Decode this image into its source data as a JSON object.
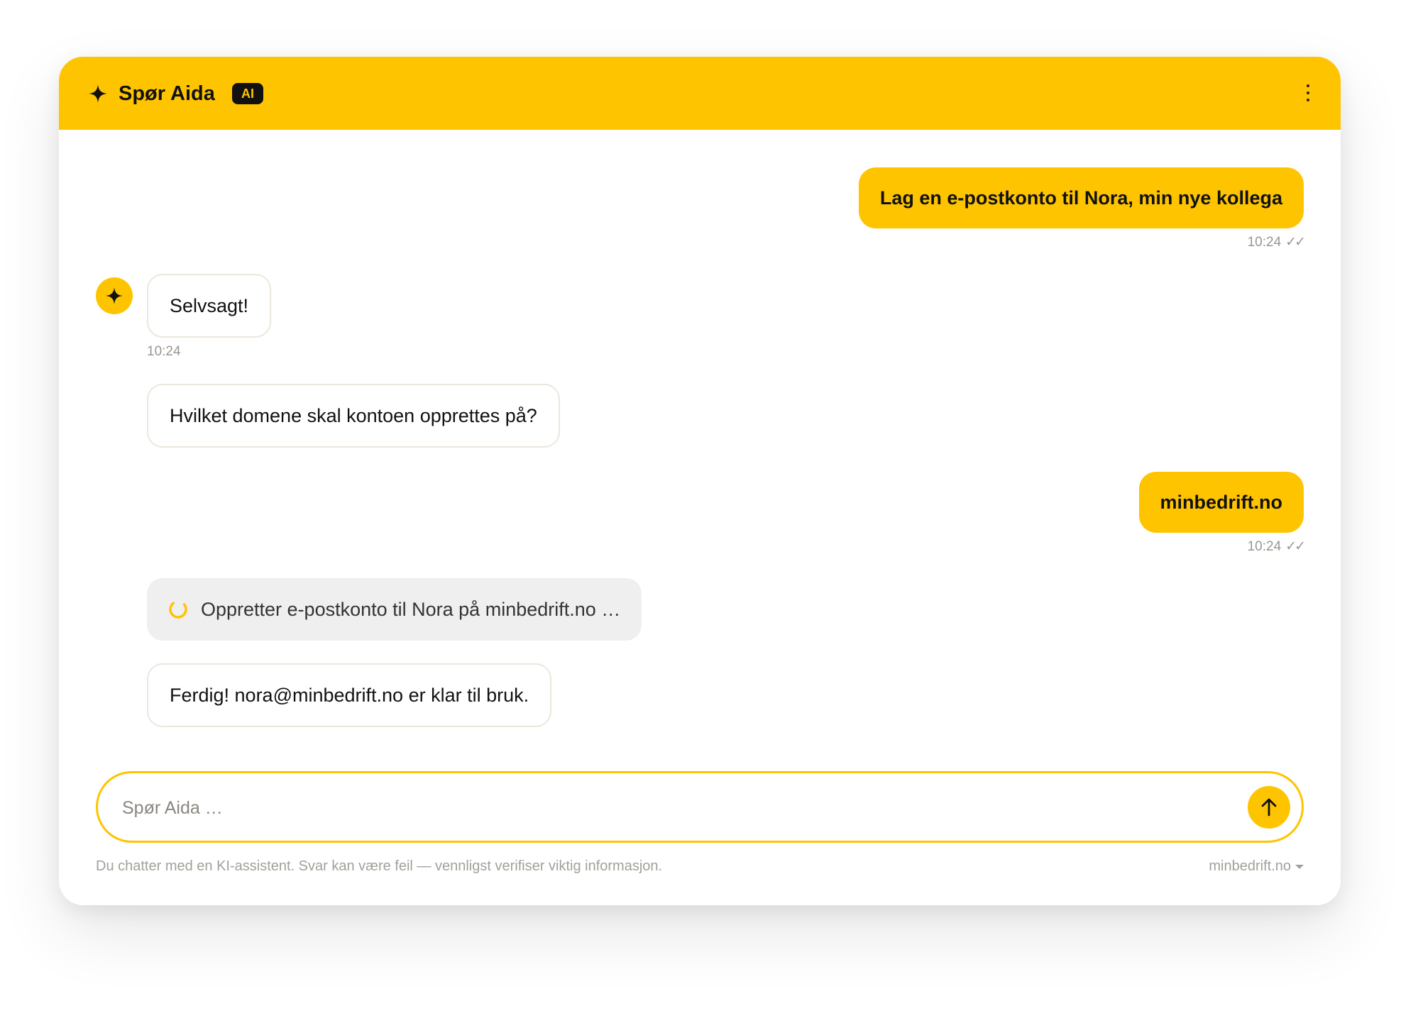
{
  "header": {
    "title": "Spør Aida",
    "badge": "AI",
    "sparkle_icon": "sparkle-icon",
    "menu_icon": "more-vertical-icon"
  },
  "colors": {
    "accent": "#FFC400",
    "text": "#111111",
    "muted": "#9a9690",
    "ai_bubble_border": "#ECE7DD",
    "status_bubble_bg": "#EFEFEF"
  },
  "messages": [
    {
      "role": "user",
      "text": "Lag en e-postkonto til Nora, min nye kollega",
      "time": "10:24",
      "read_marker": "✓✓"
    },
    {
      "role": "assistant",
      "text": "Selvsagt!",
      "time": "10:24"
    },
    {
      "role": "assistant",
      "text": "Hvilket domene skal kontoen opprettes på?"
    },
    {
      "role": "user",
      "text": "minbedrift.no",
      "time": "10:24",
      "read_marker": "✓✓"
    },
    {
      "role": "status",
      "text": "Oppretter e-postkonto til Nora på minbedrift.no …"
    },
    {
      "role": "assistant",
      "text": "Ferdig! nora@minbedrift.no er klar til bruk."
    }
  ],
  "composer": {
    "placeholder": "Spør Aida …",
    "send_icon": "arrow-up-icon"
  },
  "footer": {
    "disclaimer": "Du chatter med en KI-assistent. Svar kan være feil — vennligst verifiser viktig informasjon.",
    "domain": "minbedrift.no"
  }
}
